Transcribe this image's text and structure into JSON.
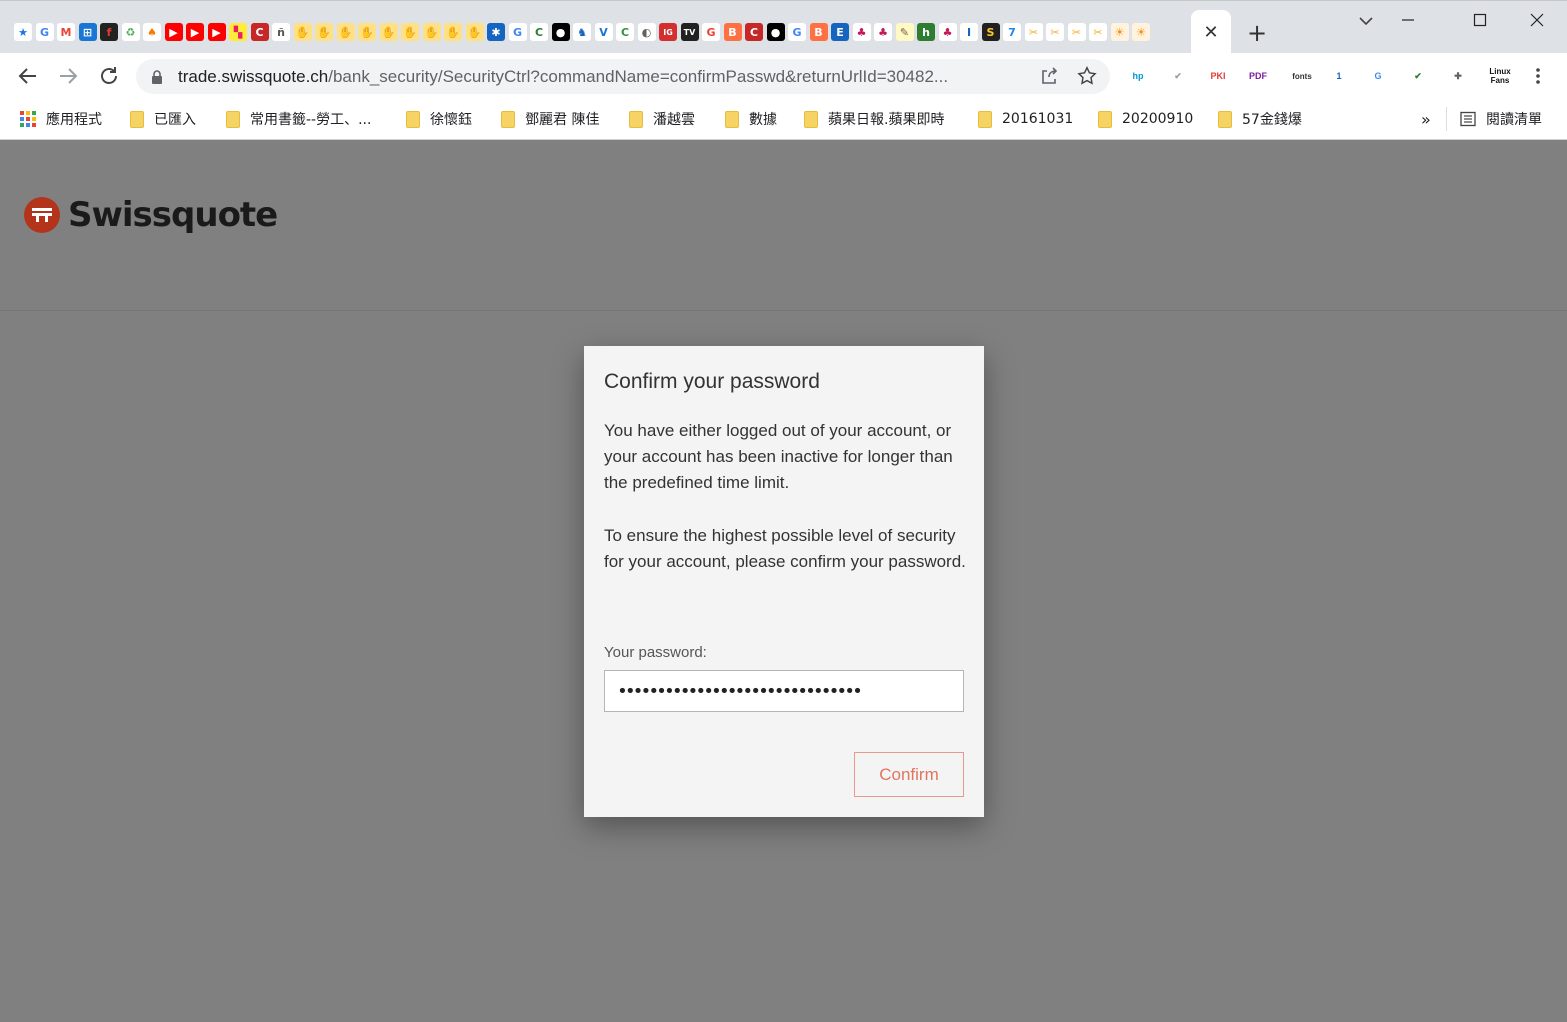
{
  "tabs": {
    "favicons": [
      {
        "icon": "bookmark-star-icon",
        "glyph": "★",
        "bg": "#ffffff",
        "fg": "#1a73e8"
      },
      {
        "icon": "google-translate-icon",
        "glyph": "G",
        "bg": "#ffffff",
        "fg": "#4285f4"
      },
      {
        "icon": "gmail-icon",
        "glyph": "M",
        "bg": "#ffffff",
        "fg": "#ea4335"
      },
      {
        "icon": "windows-grid-icon",
        "glyph": "⊞",
        "bg": "#1976d2",
        "fg": "#ffffff"
      },
      {
        "icon": "flipboard-icon",
        "glyph": "f",
        "bg": "#222222",
        "fg": "#e53935"
      },
      {
        "icon": "shop-bag-icon",
        "glyph": "♻",
        "bg": "#ffffff",
        "fg": "#4caf50"
      },
      {
        "icon": "flame-icon",
        "glyph": "♠",
        "bg": "#ffffff",
        "fg": "#f57c00"
      },
      {
        "icon": "youtube-icon",
        "glyph": "▶",
        "bg": "#ff0000",
        "fg": "#ffffff"
      },
      {
        "icon": "youtube-icon",
        "glyph": "▶",
        "bg": "#ff0000",
        "fg": "#ffffff"
      },
      {
        "icon": "youtube-icon",
        "glyph": "▶",
        "bg": "#ff0000",
        "fg": "#ffffff"
      },
      {
        "icon": "colorful-blocks-icon",
        "glyph": "▚",
        "bg": "#ffeb3b",
        "fg": "#e91e63"
      },
      {
        "icon": "cd-icon",
        "glyph": "C",
        "bg": "#c62828",
        "fg": "#ffffff"
      },
      {
        "icon": "news-icon",
        "glyph": "ñ",
        "bg": "#ffffff",
        "fg": "#555555"
      },
      {
        "icon": "hand-icon",
        "glyph": "✋",
        "bg": "#ffe082",
        "fg": "#e6a000"
      },
      {
        "icon": "hand-icon",
        "glyph": "✋",
        "bg": "#ffe082",
        "fg": "#e6a000"
      },
      {
        "icon": "hand-icon",
        "glyph": "✋",
        "bg": "#ffe082",
        "fg": "#e6a000"
      },
      {
        "icon": "hand-icon",
        "glyph": "✋",
        "bg": "#ffe082",
        "fg": "#e6a000"
      },
      {
        "icon": "hand-icon",
        "glyph": "✋",
        "bg": "#ffe082",
        "fg": "#e6a000"
      },
      {
        "icon": "hand-icon",
        "glyph": "✋",
        "bg": "#ffe082",
        "fg": "#e6a000"
      },
      {
        "icon": "hand-icon",
        "glyph": "✋",
        "bg": "#ffe082",
        "fg": "#e6a000"
      },
      {
        "icon": "hand-icon",
        "glyph": "✋",
        "bg": "#ffe082",
        "fg": "#e6a000"
      },
      {
        "icon": "hand-icon",
        "glyph": "✋",
        "bg": "#ffe082",
        "fg": "#e6a000"
      },
      {
        "icon": "star-badge-icon",
        "glyph": "✱",
        "bg": "#1565c0",
        "fg": "#ffffff"
      },
      {
        "icon": "google-icon",
        "glyph": "G",
        "bg": "#ffffff",
        "fg": "#4285f4"
      },
      {
        "icon": "chrome-c-icon",
        "glyph": "C",
        "bg": "#ffffff",
        "fg": "#2e7d32"
      },
      {
        "icon": "medium-icon",
        "glyph": "●",
        "bg": "#000000",
        "fg": "#ffffff"
      },
      {
        "icon": "dragon-icon",
        "glyph": "♞",
        "bg": "#ffffff",
        "fg": "#1565c0"
      },
      {
        "icon": "v-icon",
        "glyph": "V",
        "bg": "#ffffff",
        "fg": "#1976d2"
      },
      {
        "icon": "chrome-c-icon",
        "glyph": "C",
        "bg": "#ffffff",
        "fg": "#388e3c"
      },
      {
        "icon": "globe-icon",
        "glyph": "◐",
        "bg": "#ffffff",
        "fg": "#616161"
      },
      {
        "icon": "ig-icon",
        "glyph": "IG",
        "bg": "#d32f2f",
        "fg": "#ffffff"
      },
      {
        "icon": "tv-icon",
        "glyph": "TV",
        "bg": "#212121",
        "fg": "#ffffff"
      },
      {
        "icon": "google-icon",
        "glyph": "G",
        "bg": "#ffffff",
        "fg": "#ea4335"
      },
      {
        "icon": "blogger-icon",
        "glyph": "B",
        "bg": "#ff7043",
        "fg": "#ffffff"
      },
      {
        "icon": "cd-icon",
        "glyph": "C",
        "bg": "#c62828",
        "fg": "#ffffff"
      },
      {
        "icon": "medium-icon",
        "glyph": "●",
        "bg": "#000000",
        "fg": "#ffffff"
      },
      {
        "icon": "google-icon",
        "glyph": "G",
        "bg": "#ffffff",
        "fg": "#4285f4"
      },
      {
        "icon": "blogger-icon",
        "glyph": "B",
        "bg": "#ff7043",
        "fg": "#ffffff"
      },
      {
        "icon": "edge-e-icon",
        "glyph": "E",
        "bg": "#1565c0",
        "fg": "#ffffff"
      },
      {
        "icon": "raspberry-icon",
        "glyph": "♣",
        "bg": "#ffffff",
        "fg": "#c2185b"
      },
      {
        "icon": "raspberry-icon",
        "glyph": "♣",
        "bg": "#ffffff",
        "fg": "#c2185b"
      },
      {
        "icon": "pencil-note-icon",
        "glyph": "✎",
        "bg": "#fff9c4",
        "fg": "#795548"
      },
      {
        "icon": "h-icon",
        "glyph": "h",
        "bg": "#2e7d32",
        "fg": "#ffffff"
      },
      {
        "icon": "raspberry-icon",
        "glyph": "♣",
        "bg": "#ffffff",
        "fg": "#c2185b"
      },
      {
        "icon": "i-bar-icon",
        "glyph": "I",
        "bg": "#ffffff",
        "fg": "#1565c0"
      },
      {
        "icon": "s-coin-icon",
        "glyph": "S",
        "bg": "#212121",
        "fg": "#ffca28"
      },
      {
        "icon": "seven-icon",
        "glyph": "7",
        "bg": "#ffffff",
        "fg": "#1e88e5"
      },
      {
        "icon": "scissors-icon",
        "glyph": "✂",
        "bg": "#ffffff",
        "fg": "#f9a825"
      },
      {
        "icon": "scissors-icon",
        "glyph": "✂",
        "bg": "#ffffff",
        "fg": "#f9a825"
      },
      {
        "icon": "scissors-icon",
        "glyph": "✂",
        "bg": "#ffffff",
        "fg": "#f9a825"
      },
      {
        "icon": "scissors-icon",
        "glyph": "✂",
        "bg": "#ffffff",
        "fg": "#f9a825"
      },
      {
        "icon": "sun-badge-icon",
        "glyph": "☀",
        "bg": "#fff3e0",
        "fg": "#fb8c00"
      },
      {
        "icon": "sun-badge-icon",
        "glyph": "☀",
        "bg": "#fff3e0",
        "fg": "#fb8c00"
      }
    ],
    "active_close": "✕",
    "new_tab": "+"
  },
  "toolbar": {
    "url_host": "trade.swissquote.ch",
    "url_path": "/bank_security/SecurityCtrl?commandName=confirmPasswd&returnUrlId=30482...",
    "extensions": [
      {
        "icon": "hp-icon",
        "label": "hp",
        "color": "#0096d6"
      },
      {
        "icon": "checkmark-icon",
        "label": "✔",
        "color": "#9e9e9e"
      },
      {
        "icon": "smart-pki-icon",
        "label": "PKI",
        "color": "#e53935"
      },
      {
        "icon": "pdf-icon",
        "label": "PDF",
        "color": "#7b1fa2"
      },
      {
        "icon": "fonts-icon",
        "label": "fonts",
        "color": "#333333"
      },
      {
        "icon": "one-badge-icon",
        "label": "1",
        "color": "#1565c0"
      },
      {
        "icon": "google-translate-icon",
        "label": "G",
        "color": "#4285f4"
      },
      {
        "icon": "shield-check-icon",
        "label": "✔",
        "color": "#2e7d32"
      },
      {
        "icon": "puzzle-extensions-icon",
        "label": "✚",
        "color": "#5f6368"
      },
      {
        "icon": "linux-fans-icon",
        "label": "Linux Fans",
        "color": "#111111"
      }
    ]
  },
  "bookmarks": {
    "apps": "應用程式",
    "items": [
      "已匯入",
      "常用書籤--勞工、...",
      "徐懷鈺",
      "鄧麗君 陳佳",
      "潘越雲",
      "數據",
      "蘋果日報.蘋果即時",
      "20161031",
      "20200910",
      "57金錢爆"
    ],
    "more": "»",
    "reading_list": "閱讀清單"
  },
  "page": {
    "brand": "Swissquote",
    "brand_color": "#b3341b",
    "modal": {
      "title": "Confirm your password",
      "paragraph1": "You have either logged out of your account, or your account has been inactive for longer than the predefined time limit.",
      "paragraph2": "To ensure the highest possible level of security for your account, please confirm your password.",
      "password_label": "Your password:",
      "password_value": "•••••••••••••••••••••••••••••••",
      "confirm_label": "Confirm",
      "accent": "#e0755f"
    }
  }
}
